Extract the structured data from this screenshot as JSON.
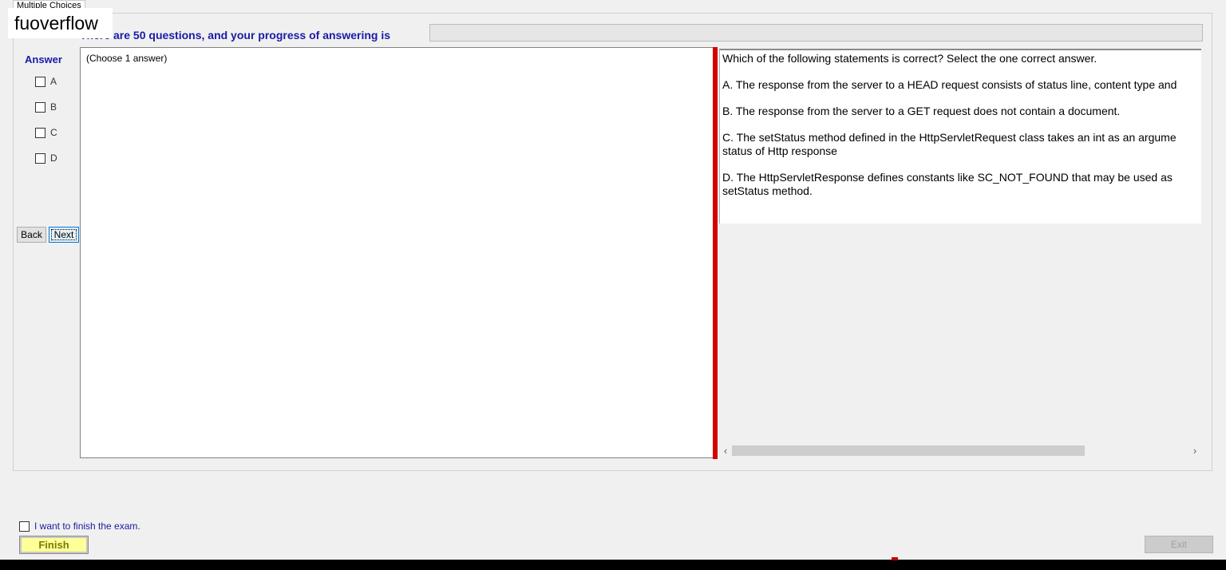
{
  "tab": {
    "label": "Multiple Choices"
  },
  "watermark": {
    "text": "fuoverflow"
  },
  "progress": {
    "text": "There are 50 questions, and your progress of answering is",
    "value_fraction": 0
  },
  "answer": {
    "heading": "Answer",
    "options": [
      {
        "label": "A",
        "checked": false
      },
      {
        "label": "B",
        "checked": false
      },
      {
        "label": "C",
        "checked": false
      },
      {
        "label": "D",
        "checked": false
      }
    ]
  },
  "nav": {
    "back_label": "Back",
    "next_label": "Next"
  },
  "choose_panel": {
    "text": "(Choose 1 answer)"
  },
  "question": {
    "prompt": "Which of the following statements is correct? Select the one correct answer.",
    "choices": [
      "A.  The response from the server to a HEAD request consists of status line, content type and",
      "B.  The response from the server to a GET request does not contain a document.",
      "C.  The setStatus method defined in the HttpServletRequest class takes an int as an argume",
      "D.  The HttpServletResponse defines constants like SC_NOT_FOUND that may be used as"
    ],
    "choice_continuations": [
      "",
      "",
      "status of Http response",
      "setStatus method."
    ]
  },
  "scrollbar": {
    "left_arrow": "‹",
    "right_arrow": "›"
  },
  "footer": {
    "finish_checkbox_label": "I want to finish the exam.",
    "finish_label": "Finish",
    "exit_label": "Exit"
  },
  "colors": {
    "heading_blue": "#1a1aa6",
    "splitter_red": "#d50000",
    "finish_yellow": "#ffff99"
  }
}
